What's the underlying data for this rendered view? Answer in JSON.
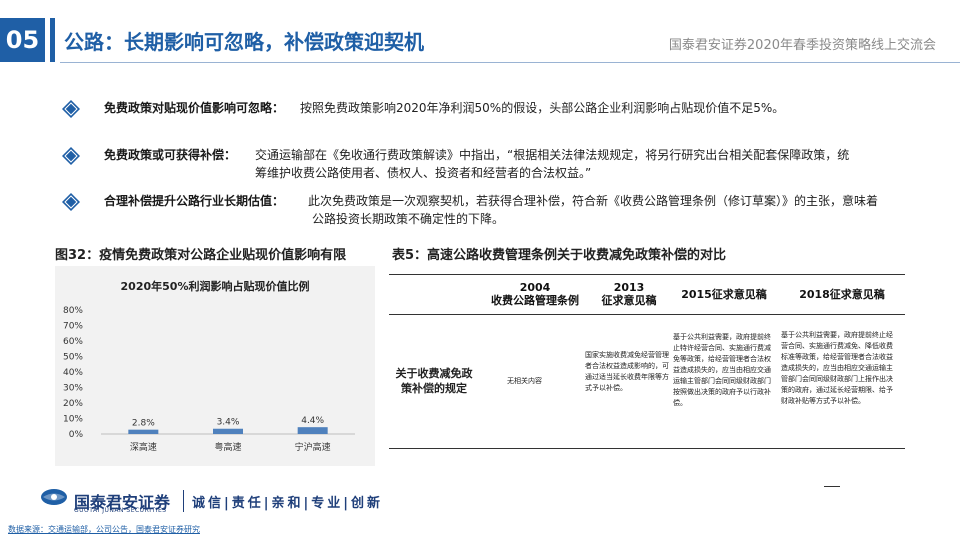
{
  "header": {
    "section_number": "05",
    "title": "公路：长期影响可忽略，补偿政策迎契机",
    "event": "国泰君安证券2020年春季投资策略线上交流会"
  },
  "bullets": [
    {
      "label": "免费政策对贴现价值影响可忽略：",
      "lines": [
        "按照免费政策影响2020年净利润50%的假设，头部公路企业利润影响占贴现价值不足5%。"
      ]
    },
    {
      "label": "免费政策或可获得补偿：",
      "lines": [
        "交通运输部在《免收通行费政策解读》中指出，“根据相关法律法规规定，将另行研究出台相关配套保障政策，统",
        "筹维护收费公路使用者、债权人、投资者和经营者的合法权益。”"
      ]
    },
    {
      "label": "合理补偿提升公路行业长期估值：",
      "lines": [
        "此次免费政策是一次观察契机，若获得合理补偿，符合新《收费公路管理条例（修订草案）》的主张，意味着",
        "公路投资长期政策不确定性的下降。"
      ]
    }
  ],
  "figure": {
    "caption": "图32：疫情免费政策对公路企业贴现价值影响有限"
  },
  "table": {
    "caption": "表5：高速公路收费管理条例关于收费减免政策补偿的对比",
    "headers": [
      "",
      "2004\n收费公路管理条例",
      "2013\n征求意见稿",
      "2015征求意见稿",
      "2018征求意见稿"
    ],
    "row_label": "关于收费减免政策补偿的规定",
    "cells": [
      "无相关内容",
      "国家实施收费减免经营管理者合法权益造成影响的，可通过适当延长收费年限等方式予以补偿。",
      "基于公共利益需要，政府提前终止特许经营合同、实施通行费减免等政策，给经营管理者合法权益造成损失的，应当由相应交通运输主管部门会同同级财政部门按照做出决策的政府予以行政补偿。",
      "基于公共利益需要，政府提前终止经营合同、实施通行费减免、降低收费标准等政策，给经营管理者合法收益造成损失的，应当由相应交通运输主管部门会同同级财政部门上报作出决策的政府，通过延长经营期限、给予财政补贴等方式予以补偿。"
    ]
  },
  "footer": {
    "company": "国泰君安证券",
    "company_en": "GUOTAI JUNAN SECURITIES",
    "slogan": "诚信|责任|亲和|专业|创新",
    "source": "数据来源：交通运输部，公司公告，国泰君安证券研究"
  },
  "colors": {
    "brand": "#1f5fa6",
    "bar": "#4f81bd"
  },
  "chart_data": {
    "type": "bar",
    "title": "2020年50%利润影响占贴现价值比例",
    "categories": [
      "深高速",
      "粤高速",
      "宁沪高速"
    ],
    "values": [
      2.8,
      3.4,
      4.4
    ],
    "value_labels": [
      "2.8%",
      "3.4%",
      "4.4%"
    ],
    "ylim": [
      0,
      80
    ],
    "yticks": [
      "0%",
      "10%",
      "20%",
      "30%",
      "40%",
      "50%",
      "60%",
      "70%",
      "80%"
    ],
    "grid": false,
    "legend": "none"
  }
}
